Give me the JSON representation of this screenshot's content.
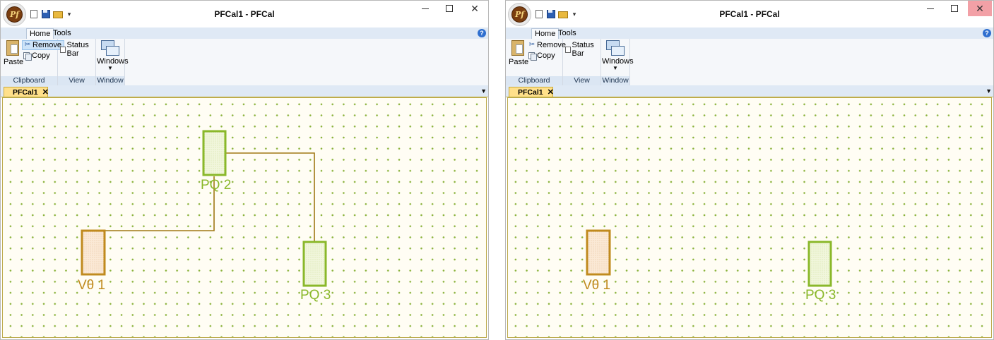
{
  "windows": [
    {
      "title": "PFCal1 - PFCal",
      "app_logo_text": "Pf",
      "qat_more": "▾",
      "ribbon_tabs": [
        "Home",
        "Tools"
      ],
      "help": "?",
      "clipboard": {
        "paste": "Paste",
        "remove": "Remove",
        "copy": "Copy",
        "group": "Clipboard"
      },
      "view": {
        "status_bar": "Status Bar",
        "group": "View"
      },
      "window": {
        "windows": "Windows",
        "group": "Window"
      },
      "doc_tab": {
        "label": "PFCal1",
        "close": "✕"
      },
      "buses": [
        {
          "label": "Vθ 1",
          "type": "slack"
        },
        {
          "label": "PQ 2",
          "type": "PQ"
        },
        {
          "label": "PQ 3",
          "type": "PQ"
        }
      ],
      "lines": [
        [
          "Vθ 1",
          "PQ 2"
        ],
        [
          "PQ 2",
          "PQ 3"
        ]
      ]
    },
    {
      "title": "PFCal1 - PFCal",
      "app_logo_text": "Pf",
      "qat_more": "▾",
      "ribbon_tabs": [
        "Home",
        "Tools"
      ],
      "help": "?",
      "clipboard": {
        "paste": "Paste",
        "remove": "Remove",
        "copy": "Copy",
        "group": "Clipboard"
      },
      "view": {
        "status_bar": "Status Bar",
        "group": "View"
      },
      "window": {
        "windows": "Windows",
        "group": "Window"
      },
      "doc_tab": {
        "label": "PFCal1",
        "close": "✕"
      },
      "buses": [
        {
          "label": "Vθ 1",
          "type": "slack"
        },
        {
          "label": "PQ 3",
          "type": "PQ"
        }
      ],
      "lines": []
    }
  ],
  "colors": {
    "slack_bus": "#c08a1e",
    "pq_bus": "#8ab82a",
    "line": "#a07814",
    "grid_dot": "#8ab23b",
    "close_hover": "#f2a0a6"
  }
}
